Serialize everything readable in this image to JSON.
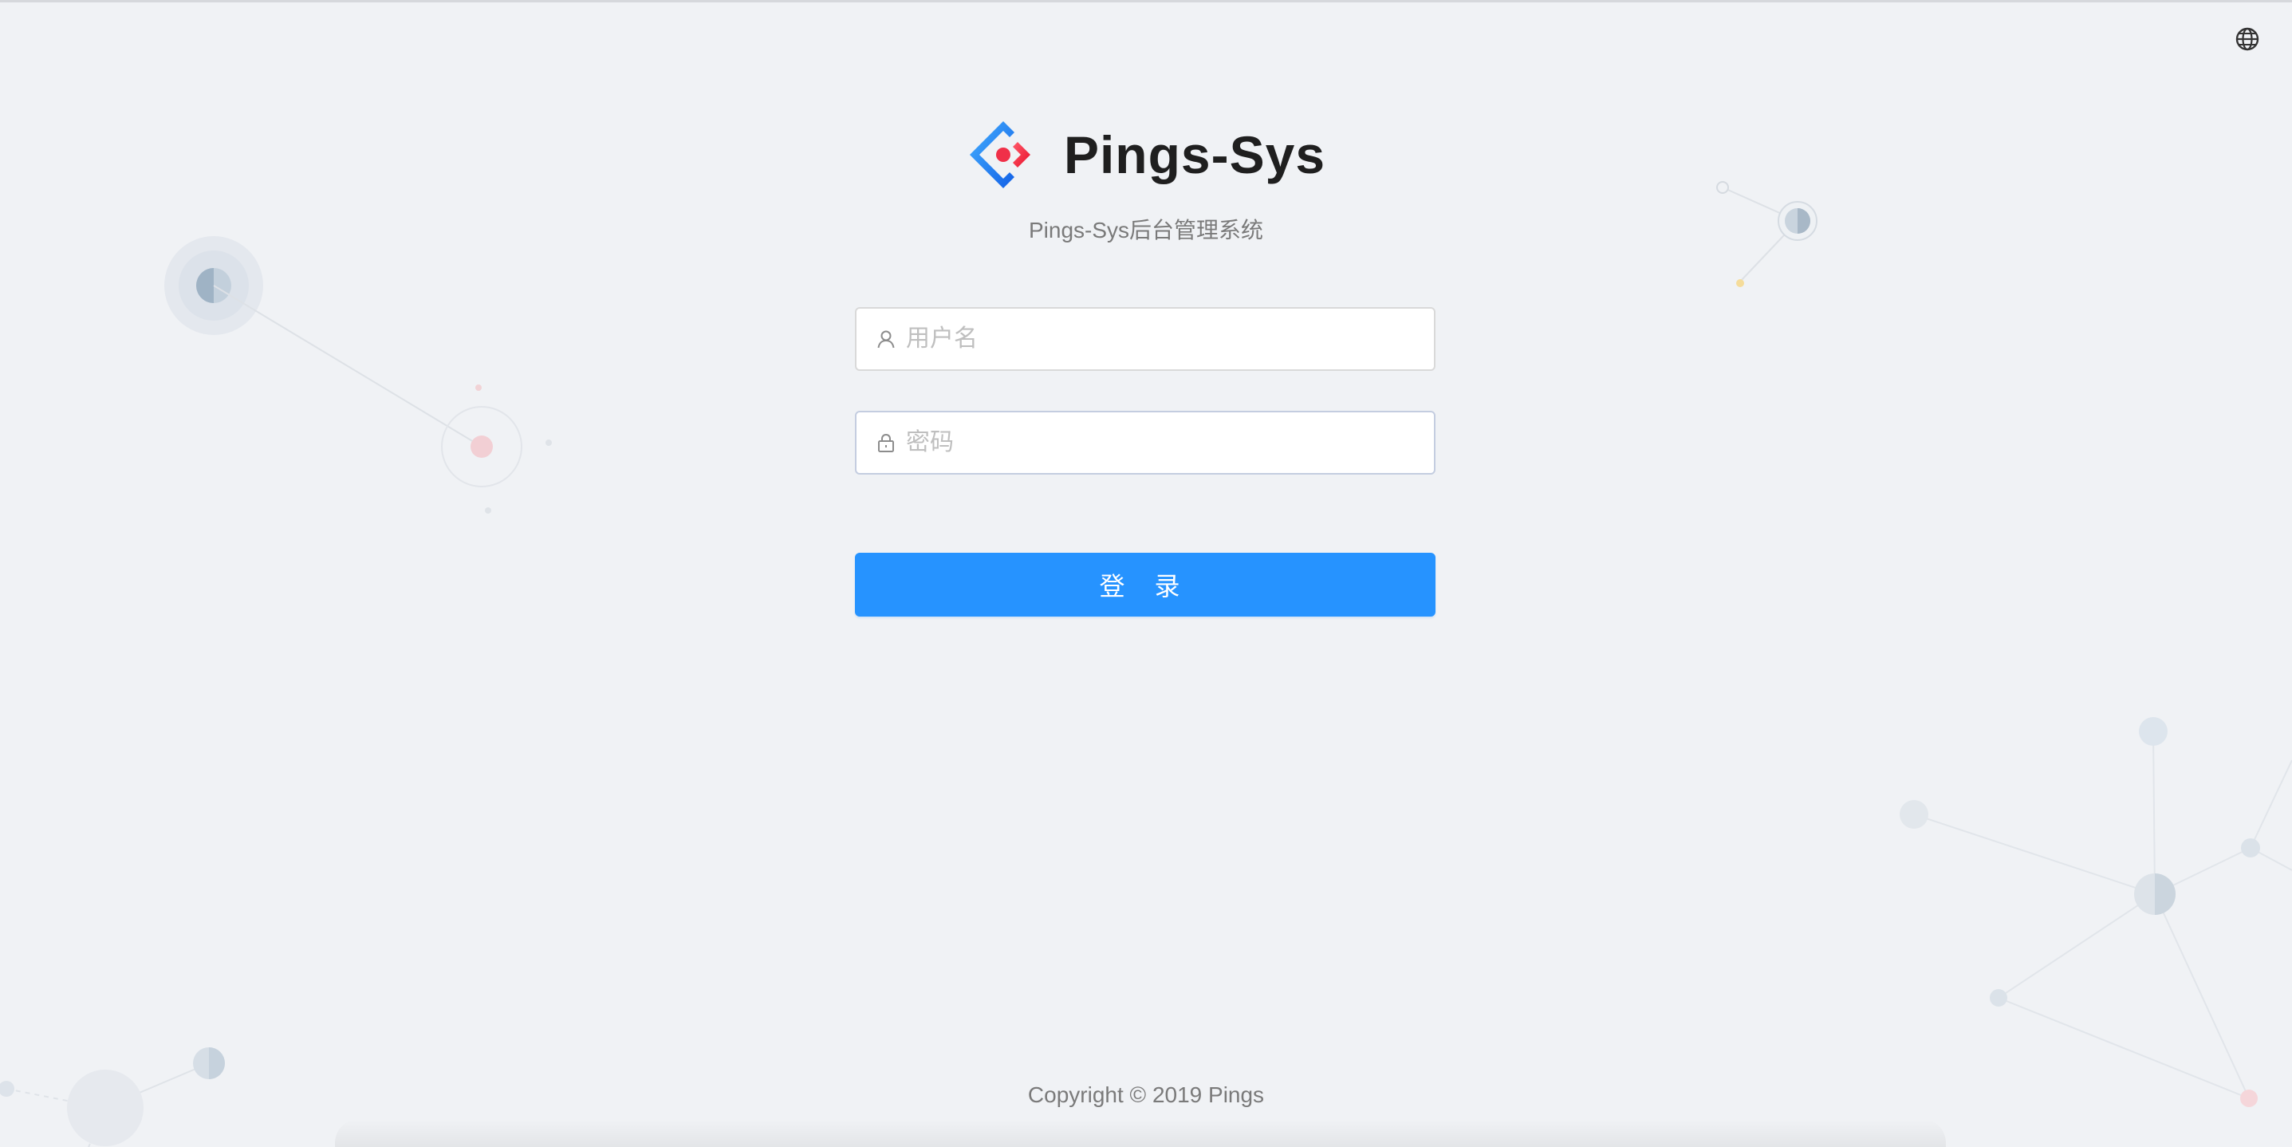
{
  "brand": {
    "title": "Pings-Sys",
    "subtitle": "Pings-Sys后台管理系统",
    "logo_icon": "pings-logo-icon"
  },
  "header": {
    "language_icon": "globe-icon"
  },
  "form": {
    "username": {
      "placeholder": "用户名",
      "value": "",
      "icon": "user-icon"
    },
    "password": {
      "placeholder": "密码",
      "value": "",
      "icon": "lock-icon"
    },
    "submit_label": "登 录"
  },
  "footer": {
    "copyright": "Copyright © 2019 Pings"
  },
  "colors": {
    "background": "#f0f2f5",
    "primary": "#2693ff",
    "logo_blue": "#1890ff",
    "logo_red": "#f5222d"
  }
}
